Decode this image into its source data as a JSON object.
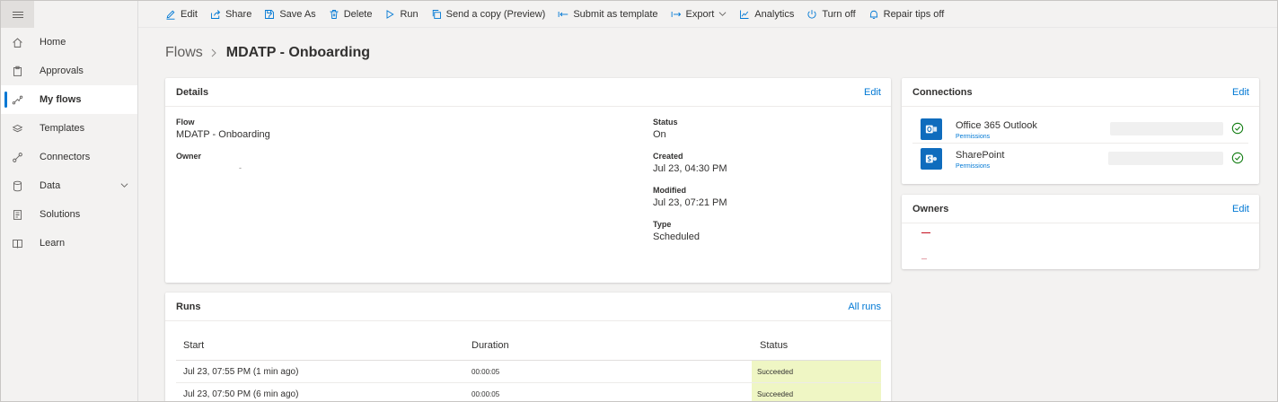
{
  "toolbar": {
    "items": [
      {
        "label": "Edit",
        "icon": "pencil-icon"
      },
      {
        "label": "Share",
        "icon": "share-icon"
      },
      {
        "label": "Save As",
        "icon": "save-as-icon"
      },
      {
        "label": "Delete",
        "icon": "trash-icon"
      },
      {
        "label": "Run",
        "icon": "play-icon"
      },
      {
        "label": "Send a copy (Preview)",
        "icon": "copy-icon"
      },
      {
        "label": "Submit as template",
        "icon": "template-arrow-icon"
      },
      {
        "label": "Export",
        "icon": "export-arrow-icon"
      },
      {
        "label": "Analytics",
        "icon": "analytics-icon"
      },
      {
        "label": "Turn off",
        "icon": "power-icon"
      },
      {
        "label": "Repair tips off",
        "icon": "bell-icon"
      }
    ]
  },
  "sidebar": {
    "items": [
      {
        "label": "Home",
        "icon": "home-icon"
      },
      {
        "label": "Approvals",
        "icon": "approvals-icon"
      },
      {
        "label": "My flows",
        "icon": "flows-icon",
        "active": true
      },
      {
        "label": "Templates",
        "icon": "templates-icon"
      },
      {
        "label": "Connectors",
        "icon": "connectors-icon"
      },
      {
        "label": "Data",
        "icon": "database-icon",
        "expandable": true
      },
      {
        "label": "Solutions",
        "icon": "solutions-icon"
      },
      {
        "label": "Learn",
        "icon": "book-icon"
      }
    ]
  },
  "breadcrumb": {
    "root": "Flows",
    "current": "MDATP - Onboarding"
  },
  "details": {
    "title": "Details",
    "edit_label": "Edit",
    "flow_label": "Flow",
    "flow_value": "MDATP - Onboarding",
    "owner_label": "Owner",
    "owner_value": "-",
    "status_label": "Status",
    "status_value": "On",
    "created_label": "Created",
    "created_value": "Jul 23, 04:30 PM",
    "modified_label": "Modified",
    "modified_value": "Jul 23, 07:21 PM",
    "type_label": "Type",
    "type_value": "Scheduled"
  },
  "runs": {
    "title": "Runs",
    "all_runs_label": "All runs",
    "columns": [
      "Start",
      "Duration",
      "Status"
    ],
    "rows": [
      {
        "start": "Jul 23, 07:55 PM (1 min ago)",
        "duration": "00:00:05",
        "status": "Succeeded"
      },
      {
        "start": "Jul 23, 07:50 PM (6 min ago)",
        "duration": "00:00:05",
        "status": "Succeeded"
      }
    ]
  },
  "connections": {
    "title": "Connections",
    "edit_label": "Edit",
    "items": [
      {
        "name": "Office 365 Outlook",
        "permissions_label": "Permissions",
        "icon": "outlook-icon"
      },
      {
        "name": "SharePoint",
        "permissions_label": "Permissions",
        "icon": "sharepoint-icon"
      }
    ]
  },
  "owners": {
    "title": "Owners",
    "edit_label": "Edit"
  },
  "colors": {
    "accent": "#0078d4",
    "success": "#107c10",
    "succeeded_bg": "#eff6c4",
    "connector_blue": "#0f6cbd"
  }
}
